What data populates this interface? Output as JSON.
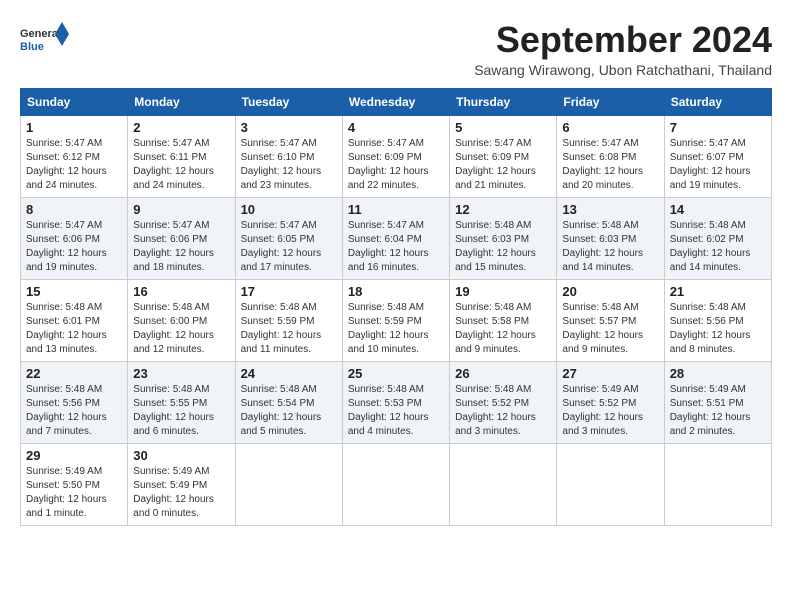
{
  "header": {
    "logo_general": "General",
    "logo_blue": "Blue",
    "month_title": "September 2024",
    "location": "Sawang Wirawong, Ubon Ratchathani, Thailand"
  },
  "weekdays": [
    "Sunday",
    "Monday",
    "Tuesday",
    "Wednesday",
    "Thursday",
    "Friday",
    "Saturday"
  ],
  "weeks": [
    [
      {
        "day": "1",
        "info": "Sunrise: 5:47 AM\nSunset: 6:12 PM\nDaylight: 12 hours\nand 24 minutes."
      },
      {
        "day": "2",
        "info": "Sunrise: 5:47 AM\nSunset: 6:11 PM\nDaylight: 12 hours\nand 24 minutes."
      },
      {
        "day": "3",
        "info": "Sunrise: 5:47 AM\nSunset: 6:10 PM\nDaylight: 12 hours\nand 23 minutes."
      },
      {
        "day": "4",
        "info": "Sunrise: 5:47 AM\nSunset: 6:09 PM\nDaylight: 12 hours\nand 22 minutes."
      },
      {
        "day": "5",
        "info": "Sunrise: 5:47 AM\nSunset: 6:09 PM\nDaylight: 12 hours\nand 21 minutes."
      },
      {
        "day": "6",
        "info": "Sunrise: 5:47 AM\nSunset: 6:08 PM\nDaylight: 12 hours\nand 20 minutes."
      },
      {
        "day": "7",
        "info": "Sunrise: 5:47 AM\nSunset: 6:07 PM\nDaylight: 12 hours\nand 19 minutes."
      }
    ],
    [
      {
        "day": "8",
        "info": "Sunrise: 5:47 AM\nSunset: 6:06 PM\nDaylight: 12 hours\nand 19 minutes."
      },
      {
        "day": "9",
        "info": "Sunrise: 5:47 AM\nSunset: 6:06 PM\nDaylight: 12 hours\nand 18 minutes."
      },
      {
        "day": "10",
        "info": "Sunrise: 5:47 AM\nSunset: 6:05 PM\nDaylight: 12 hours\nand 17 minutes."
      },
      {
        "day": "11",
        "info": "Sunrise: 5:47 AM\nSunset: 6:04 PM\nDaylight: 12 hours\nand 16 minutes."
      },
      {
        "day": "12",
        "info": "Sunrise: 5:48 AM\nSunset: 6:03 PM\nDaylight: 12 hours\nand 15 minutes."
      },
      {
        "day": "13",
        "info": "Sunrise: 5:48 AM\nSunset: 6:03 PM\nDaylight: 12 hours\nand 14 minutes."
      },
      {
        "day": "14",
        "info": "Sunrise: 5:48 AM\nSunset: 6:02 PM\nDaylight: 12 hours\nand 14 minutes."
      }
    ],
    [
      {
        "day": "15",
        "info": "Sunrise: 5:48 AM\nSunset: 6:01 PM\nDaylight: 12 hours\nand 13 minutes."
      },
      {
        "day": "16",
        "info": "Sunrise: 5:48 AM\nSunset: 6:00 PM\nDaylight: 12 hours\nand 12 minutes."
      },
      {
        "day": "17",
        "info": "Sunrise: 5:48 AM\nSunset: 5:59 PM\nDaylight: 12 hours\nand 11 minutes."
      },
      {
        "day": "18",
        "info": "Sunrise: 5:48 AM\nSunset: 5:59 PM\nDaylight: 12 hours\nand 10 minutes."
      },
      {
        "day": "19",
        "info": "Sunrise: 5:48 AM\nSunset: 5:58 PM\nDaylight: 12 hours\nand 9 minutes."
      },
      {
        "day": "20",
        "info": "Sunrise: 5:48 AM\nSunset: 5:57 PM\nDaylight: 12 hours\nand 9 minutes."
      },
      {
        "day": "21",
        "info": "Sunrise: 5:48 AM\nSunset: 5:56 PM\nDaylight: 12 hours\nand 8 minutes."
      }
    ],
    [
      {
        "day": "22",
        "info": "Sunrise: 5:48 AM\nSunset: 5:56 PM\nDaylight: 12 hours\nand 7 minutes."
      },
      {
        "day": "23",
        "info": "Sunrise: 5:48 AM\nSunset: 5:55 PM\nDaylight: 12 hours\nand 6 minutes."
      },
      {
        "day": "24",
        "info": "Sunrise: 5:48 AM\nSunset: 5:54 PM\nDaylight: 12 hours\nand 5 minutes."
      },
      {
        "day": "25",
        "info": "Sunrise: 5:48 AM\nSunset: 5:53 PM\nDaylight: 12 hours\nand 4 minutes."
      },
      {
        "day": "26",
        "info": "Sunrise: 5:48 AM\nSunset: 5:52 PM\nDaylight: 12 hours\nand 3 minutes."
      },
      {
        "day": "27",
        "info": "Sunrise: 5:49 AM\nSunset: 5:52 PM\nDaylight: 12 hours\nand 3 minutes."
      },
      {
        "day": "28",
        "info": "Sunrise: 5:49 AM\nSunset: 5:51 PM\nDaylight: 12 hours\nand 2 minutes."
      }
    ],
    [
      {
        "day": "29",
        "info": "Sunrise: 5:49 AM\nSunset: 5:50 PM\nDaylight: 12 hours\nand 1 minute."
      },
      {
        "day": "30",
        "info": "Sunrise: 5:49 AM\nSunset: 5:49 PM\nDaylight: 12 hours\nand 0 minutes."
      },
      {
        "day": "",
        "info": ""
      },
      {
        "day": "",
        "info": ""
      },
      {
        "day": "",
        "info": ""
      },
      {
        "day": "",
        "info": ""
      },
      {
        "day": "",
        "info": ""
      }
    ]
  ]
}
